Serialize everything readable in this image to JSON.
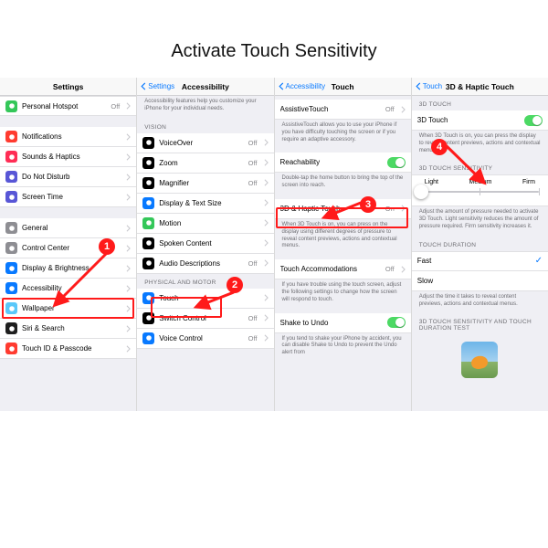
{
  "title": "Activate Touch Sensitivity",
  "badges": [
    "1",
    "2",
    "3",
    "4"
  ],
  "col1": {
    "nav_title": "Settings",
    "rows": [
      {
        "label": "Personal Hotspot",
        "value": "Off",
        "color": "#34c759"
      },
      {
        "sep": true
      },
      {
        "label": "Notifications",
        "color": "#ff3b30"
      },
      {
        "label": "Sounds & Haptics",
        "color": "#ff2d55"
      },
      {
        "label": "Do Not Disturb",
        "color": "#5856d6"
      },
      {
        "label": "Screen Time",
        "color": "#5856d6"
      },
      {
        "sep": true
      },
      {
        "label": "General",
        "color": "#8e8e93"
      },
      {
        "label": "Control Center",
        "color": "#8e8e93"
      },
      {
        "label": "Display & Brightness",
        "color": "#0879ff"
      },
      {
        "label": "Accessibility",
        "color": "#0879ff",
        "hl": true
      },
      {
        "label": "Wallpaper",
        "color": "#5ac8fa"
      },
      {
        "label": "Siri & Search",
        "color": "#1f1f1f"
      },
      {
        "label": "Touch ID & Passcode",
        "color": "#ff3b30"
      }
    ]
  },
  "col2": {
    "back": "Settings",
    "nav_title": "Accessibility",
    "intro": "Accessibility features help you customize your iPhone for your individual needs.",
    "groups": [
      {
        "header": "VISION",
        "rows": [
          {
            "label": "VoiceOver",
            "value": "Off",
            "color": "#000"
          },
          {
            "label": "Zoom",
            "value": "Off",
            "color": "#000"
          },
          {
            "label": "Magnifier",
            "value": "Off",
            "color": "#000"
          },
          {
            "label": "Display & Text Size",
            "color": "#0879ff"
          },
          {
            "label": "Motion",
            "color": "#34c759"
          },
          {
            "label": "Spoken Content",
            "color": "#000"
          },
          {
            "label": "Audio Descriptions",
            "value": "Off",
            "color": "#000"
          }
        ]
      },
      {
        "header": "PHYSICAL AND MOTOR",
        "rows": [
          {
            "label": "Touch",
            "color": "#0879ff",
            "hl": true
          },
          {
            "label": "Switch Control",
            "value": "Off",
            "color": "#000"
          },
          {
            "label": "Voice Control",
            "value": "Off",
            "color": "#0879ff"
          }
        ]
      }
    ]
  },
  "col3": {
    "back": "Accessibility",
    "nav_title": "Touch",
    "sections": [
      {
        "label": "AssistiveTouch",
        "value": "Off",
        "chev": true,
        "foot": "AssistiveTouch allows you to use your iPhone if you have difficulty touching the screen or if you require an adaptive accessory."
      },
      {
        "label": "Reachability",
        "toggle": true,
        "on": true,
        "foot": "Double-tap the home button to bring the top of the screen into reach."
      },
      {
        "label": "3D & Haptic Touch",
        "value": "On",
        "chev": true,
        "hl": true,
        "foot": "When 3D Touch is on, you can press on the display using different degrees of pressure to reveal content previews, actions and contextual menus."
      },
      {
        "label": "Touch Accommodations",
        "value": "Off",
        "chev": true,
        "foot": "If you have trouble using the touch screen, adjust the following settings to change how the screen will respond to touch."
      },
      {
        "label": "Shake to Undo",
        "toggle": true,
        "on": true,
        "foot": "If you tend to shake your iPhone by accident, you can disable Shake to Undo to prevent the Undo alert from"
      }
    ]
  },
  "col4": {
    "back": "Touch",
    "nav_title": "3D & Haptic Touch",
    "group1_header": "3D TOUCH",
    "row1_label": "3D Touch",
    "row1_foot": "When 3D Touch is on, you can press the display to reveal content previews, actions and contextual menus.",
    "group2_header": "3D TOUCH SENSITIVITY",
    "seg": [
      "Light",
      "Medium",
      "Firm"
    ],
    "seg_foot": "Adjust the amount of pressure needed to activate 3D Touch. Light sensitivity reduces the amount of pressure required. Firm sensitivity increases it.",
    "group3_header": "TOUCH DURATION",
    "dur": [
      {
        "label": "Fast",
        "checked": true
      },
      {
        "label": "Slow"
      }
    ],
    "dur_foot": "Adjust the time it takes to reveal content previews, actions and contextual menus.",
    "group4_header": "3D TOUCH SENSITIVITY AND TOUCH DURATION TEST"
  }
}
